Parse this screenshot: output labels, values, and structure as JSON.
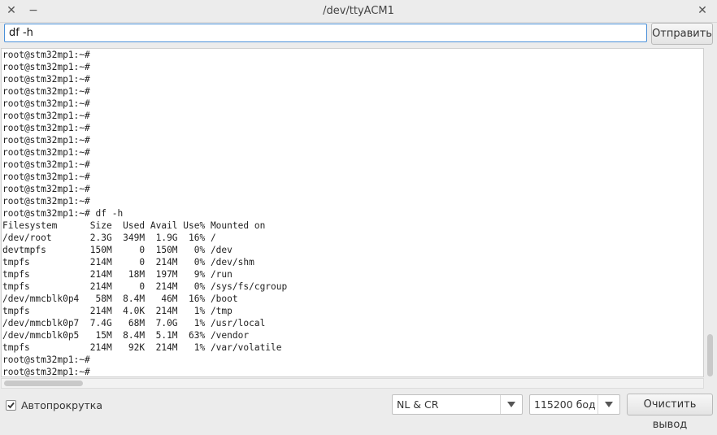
{
  "window": {
    "title": "/dev/ttyACM1",
    "close_symbol": "✕",
    "minimize_symbol": "−",
    "maximize_symbol": "✕"
  },
  "input": {
    "value": "df -h",
    "send_label": "Отправить"
  },
  "terminal": {
    "lines": [
      "root@stm32mp1:~#",
      "root@stm32mp1:~#",
      "root@stm32mp1:~#",
      "root@stm32mp1:~#",
      "root@stm32mp1:~#",
      "root@stm32mp1:~#",
      "root@stm32mp1:~#",
      "root@stm32mp1:~#",
      "root@stm32mp1:~#",
      "root@stm32mp1:~#",
      "root@stm32mp1:~#",
      "root@stm32mp1:~#",
      "root@stm32mp1:~#",
      "root@stm32mp1:~# df -h",
      "Filesystem      Size  Used Avail Use% Mounted on",
      "/dev/root       2.3G  349M  1.9G  16% /",
      "devtmpfs        150M     0  150M   0% /dev",
      "tmpfs           214M     0  214M   0% /dev/shm",
      "tmpfs           214M   18M  197M   9% /run",
      "tmpfs           214M     0  214M   0% /sys/fs/cgroup",
      "/dev/mmcblk0p4   58M  8.4M   46M  16% /boot",
      "tmpfs           214M  4.0K  214M   1% /tmp",
      "/dev/mmcblk0p7  7.4G   68M  7.0G   1% /usr/local",
      "/dev/mmcblk0p5   15M  8.4M  5.1M  63% /vendor",
      "tmpfs           214M   92K  214M   1% /var/volatile",
      "root@stm32mp1:~#",
      "root@stm32mp1:~#"
    ]
  },
  "footer": {
    "autoscroll_label": "Автопрокрутка",
    "autoscroll_checked": true,
    "line_ending": "NL & CR",
    "baud_rate": "115200 бод",
    "clear_label": "Очистить вывод"
  }
}
